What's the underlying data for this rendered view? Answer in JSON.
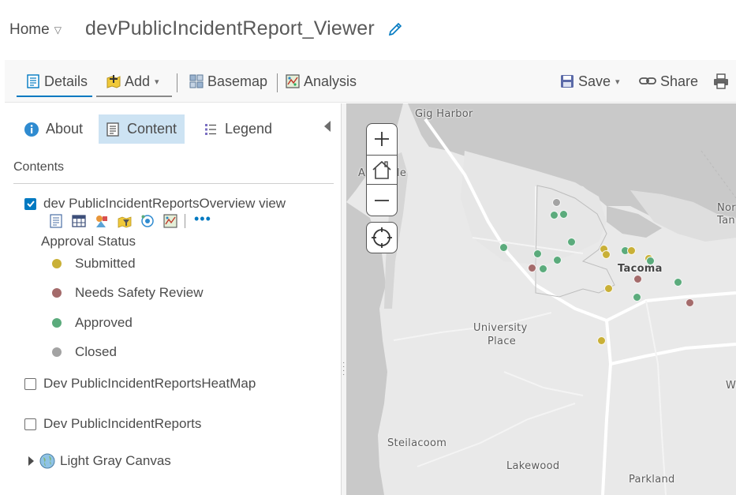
{
  "header": {
    "home_label": "Home",
    "home_caret": "▽",
    "map_title": "devPublicIncidentReport_Viewer"
  },
  "toolbar": {
    "details_label": "Details",
    "add_label": "Add",
    "basemap_label": "Basemap",
    "analysis_label": "Analysis",
    "save_label": "Save",
    "share_label": "Share",
    "caret": "▾"
  },
  "side_panel": {
    "tabs": [
      {
        "label": "About",
        "icon": "info-icon"
      },
      {
        "label": "Content",
        "icon": "content-icon",
        "active": true
      },
      {
        "label": "Legend",
        "icon": "legend-icon"
      }
    ],
    "contents_heading": "Contents",
    "layers": [
      {
        "label": "dev PublicIncidentReportsOverview view",
        "checked": true
      },
      {
        "label": "Dev PublicIncidentReportsHeatMap",
        "checked": false
      },
      {
        "label": "Dev PublicIncidentReports",
        "checked": false
      }
    ],
    "layer_tools": [
      "show-item-details-icon",
      "show-table-icon",
      "change-style-icon",
      "filter-icon",
      "perform-analysis-icon",
      "show-legend-icon"
    ],
    "more_label": "•••",
    "legend": {
      "title": "Approval Status",
      "items": [
        {
          "label": "Submitted",
          "color": "#c9b037"
        },
        {
          "label": "Needs Safety Review",
          "color": "#a46b6b"
        },
        {
          "label": "Approved",
          "color": "#5bab7c"
        },
        {
          "label": "Closed",
          "color": "#a3a3a3"
        }
      ]
    },
    "basemap_layer": {
      "label": "Light Gray Canvas"
    }
  },
  "map": {
    "labels": [
      {
        "text": "Gig Harbor",
        "bold": false
      },
      {
        "text": "A",
        "bold": false
      },
      {
        "text": "le",
        "bold": false
      },
      {
        "text": "Tacoma",
        "bold": true
      },
      {
        "text": "University",
        "bold": false
      },
      {
        "text": "Place",
        "bold": false
      },
      {
        "text": "Nor",
        "bold": false
      },
      {
        "text": "Tan",
        "bold": false
      },
      {
        "text": "W",
        "bold": false
      },
      {
        "text": "Steilacoom",
        "bold": false
      },
      {
        "text": "Lakewood",
        "bold": false
      },
      {
        "text": "Parkland",
        "bold": false
      }
    ],
    "zoom_in_label": "+",
    "zoom_out_label": "−",
    "incident_status_colors": {
      "Submitted": "#c9b037",
      "Needs Safety Review": "#a46b6b",
      "Approved": "#5bab7c",
      "Closed": "#a3a3a3"
    }
  }
}
